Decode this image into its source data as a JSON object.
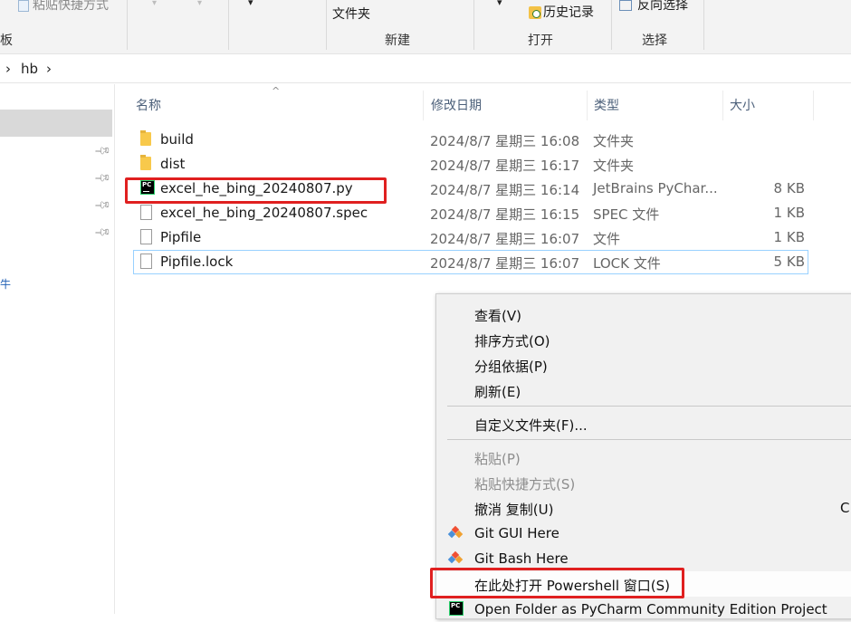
{
  "ribbon": {
    "paste_shortcut": "粘贴快捷方式",
    "clipboard_group": "板",
    "new_folder": "文件夹",
    "new_group": "新建",
    "history": "历史记录",
    "open_group": "打开",
    "invert_selection": "反向选择",
    "select_group": "选择"
  },
  "address": {
    "chevron1": "›",
    "folder": "hb",
    "chevron2": "›"
  },
  "nav": {
    "stub_label": "牛"
  },
  "columns": {
    "name": "名称",
    "date": "修改日期",
    "type": "类型",
    "size": "大小"
  },
  "files": [
    {
      "name": "build",
      "date": "2024/8/7 星期三 16:08",
      "type": "文件夹",
      "size": "",
      "icon": "folder-icon"
    },
    {
      "name": "dist",
      "date": "2024/8/7 星期三 16:17",
      "type": "文件夹",
      "size": "",
      "icon": "folder-icon"
    },
    {
      "name": "excel_he_bing_20240807.py",
      "date": "2024/8/7 星期三 16:14",
      "type": "JetBrains PyChar...",
      "size": "8 KB",
      "icon": "pycharm-icon"
    },
    {
      "name": "excel_he_bing_20240807.spec",
      "date": "2024/8/7 星期三 16:15",
      "type": "SPEC 文件",
      "size": "1 KB",
      "icon": "file-icon"
    },
    {
      "name": "Pipfile",
      "date": "2024/8/7 星期三 16:07",
      "type": "文件",
      "size": "1 KB",
      "icon": "file-icon"
    },
    {
      "name": "Pipfile.lock",
      "date": "2024/8/7 星期三 16:07",
      "type": "LOCK 文件",
      "size": "5 KB",
      "icon": "file-icon"
    }
  ],
  "menu": {
    "view": "查看(V)",
    "sort": "排序方式(O)",
    "group": "分组依据(P)",
    "refresh": "刷新(E)",
    "customize": "自定义文件夹(F)...",
    "paste": "粘贴(P)",
    "paste_shortcut": "粘贴快捷方式(S)",
    "undo_copy": "撤消 复制(U)",
    "undo_shortcut": "C",
    "git_gui": "Git GUI Here",
    "git_bash": "Git Bash Here",
    "powershell": "在此处打开 Powershell 窗口(S)",
    "pycharm_open": "Open Folder as PyCharm Community Edition Project"
  },
  "colors": {
    "highlight": "#e02020",
    "selection_border": "#99d1ff"
  }
}
